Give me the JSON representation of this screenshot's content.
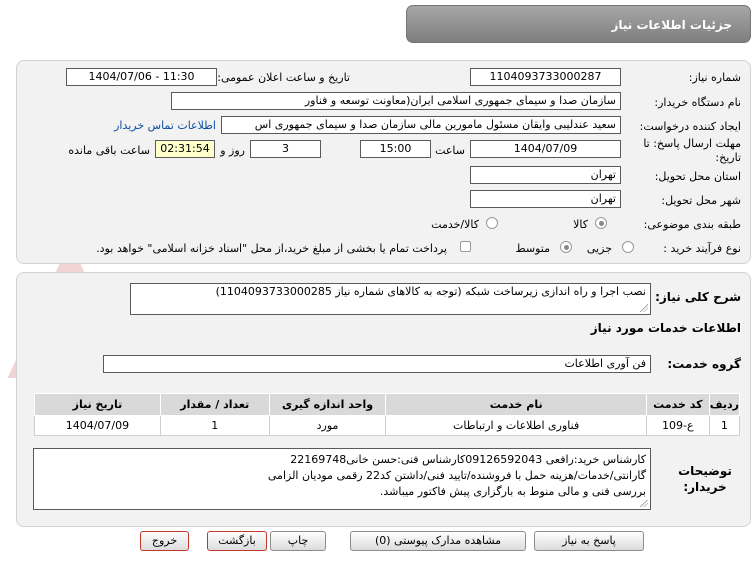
{
  "header": {
    "title": "جزئیات اطلاعات نیاز"
  },
  "form": {
    "need_number_label": "شماره نیاز:",
    "need_number": "1104093733000287",
    "announce_label": "تاریخ و ساعت اعلان عمومی:",
    "announce_value": "1404/07/06 - 11:30",
    "buyer_org_label": "نام دستگاه خریدار:",
    "buyer_org": "سازمان صدا و سیمای جمهوری اسلامی ایران(معاونت توسعه و فناور",
    "requester_label": "ایجاد کننده درخواست:",
    "requester": "سعید عندلیبی وایقان مسئول مامورین مالی  سازمان صدا و سیمای جمهوری اس",
    "buyer_contact_link": "اطلاعات تماس خریدار",
    "deadline_label": "مهلت ارسال پاسخ: تا تاریخ:",
    "deadline_date": "1404/07/09",
    "time_label": "ساعت",
    "deadline_time": "15:00",
    "days_value": "3",
    "days_label": "روز و",
    "remaining_time": "02:31:54",
    "remaining_label": "ساعت باقی مانده",
    "province_label": "استان محل تحویل:",
    "province": "تهران",
    "city_label": "شهر محل تحویل:",
    "city": "تهران",
    "category_label": "طبقه بندی موضوعی:",
    "category_options": [
      "کالا",
      "کالا/خدمت"
    ],
    "process_label": "نوع فرآیند خرید :",
    "process_options": [
      "جزیی",
      "متوسط"
    ],
    "payment_note": "پرداخت تمام یا بخشی از مبلغ خرید،از محل \"اسناد خزانه اسلامی\" خواهد بود."
  },
  "details": {
    "summary_label": "شرح کلی نیاز:",
    "summary": "نصب اجرا و راه اندازی زیرساخت شبکه (توجه به کالاهای شماره نیاز  1104093733000285)",
    "services_heading": "اطلاعات خدمات مورد نیاز",
    "service_group_label": "گروه خدمت:",
    "service_group": "فن آوری اطلاعات",
    "buyer_notes_label": "توضیحات خریدار:",
    "buyer_notes_lines": [
      "کارشناس خرید:رافعی 09126592043کارشناس فنی:حسن خانی22169748",
      "گارانتی/خدمات/هزینه حمل با فروشنده/تایید فنی/داشتن کد22 رقمی مودیان الزامی",
      "بررسی فنی و مالی منوط به بارگزاری پیش فاکتور میباشد."
    ]
  },
  "table": {
    "headers": [
      "ردیف",
      "کد خدمت",
      "نام خدمت",
      "واحد اندازه گیری",
      "تعداد / مقدار",
      "تاریخ نیاز"
    ],
    "rows": [
      [
        "1",
        "ع-109",
        "فناوری اطلاعات و ارتباطات",
        "مورد",
        "1",
        "1404/07/09"
      ]
    ]
  },
  "buttons": {
    "reply": "پاسخ به نیاز",
    "attachments": "مشاهده مدارک پیوستی (0)",
    "print": "چاپ",
    "back": "بازگشت",
    "exit": "خروج"
  },
  "watermark": {
    "text": "AriaTender.net"
  },
  "colors": {
    "header_bg": "#8f8f8f",
    "panel_bg": "#f2f2f2",
    "link": "#0c4ea2",
    "timer_bg": "#ffffcc",
    "watermark": "#e9c9c9"
  }
}
